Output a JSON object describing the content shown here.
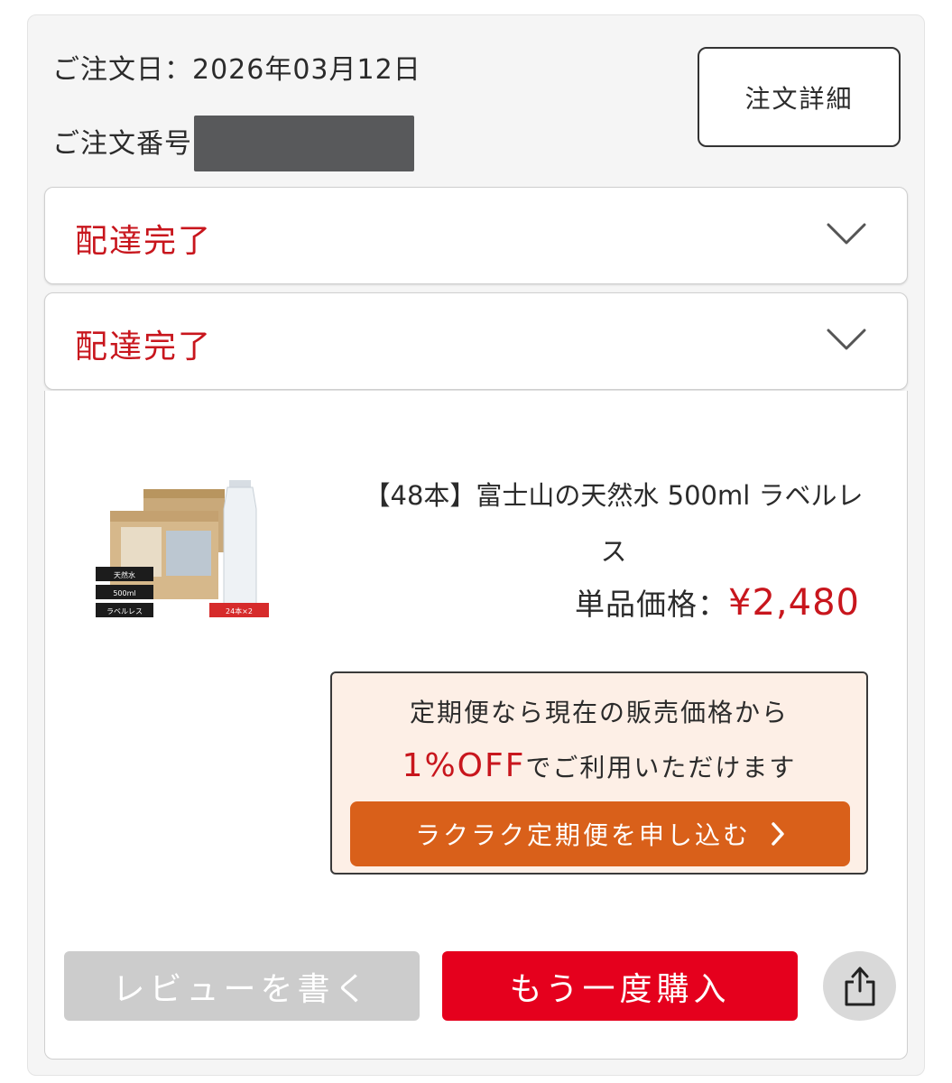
{
  "order": {
    "date_line": "ご注文日：2026年03月12日",
    "number_label": "ご注文番号",
    "detail_button": "注文詳細"
  },
  "shipments": [
    {
      "status": "配達完了"
    },
    {
      "status": "配達完了"
    }
  ],
  "product": {
    "name": "【48本】富士山の天然水 500ml ラベルレス",
    "price_label": "単品価格：",
    "price": "¥2,480",
    "image_labels": {
      "water": "天然水",
      "volume": "500ml",
      "labelless": "ラベルレス",
      "count": "24本×2"
    }
  },
  "promo": {
    "line1": "定期便なら現在の販売価格から",
    "discount": "1%OFF",
    "line2_rest": "でご利用いただけます",
    "button": "ラクラク定期便を申し込む"
  },
  "actions": {
    "review": "レビューを書く",
    "buy_again": "もう一度購入"
  },
  "colors": {
    "status_red": "#c8161d",
    "buy_red": "#e5001d",
    "promo_orange": "#d9601a",
    "promo_bg": "#fdefe6",
    "disabled_gray": "#cccccc"
  },
  "icons": [
    "chevron-down-icon",
    "chevron-right-icon",
    "share-icon"
  ]
}
